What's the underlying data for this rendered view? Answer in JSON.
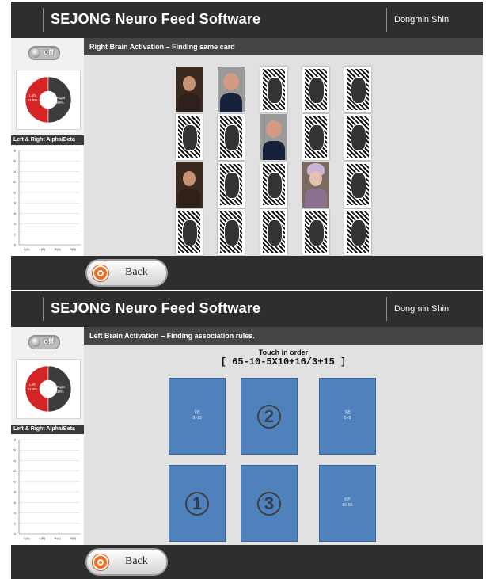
{
  "app": {
    "title": "SEJONG Neuro Feed Software",
    "user": "Dongmin Shin"
  },
  "sidebar": {
    "toggle_label": "off",
    "donut": {
      "left_label": "Left",
      "left_value": "51.8%",
      "right_label": "Right",
      "right_value": "49%",
      "left_color": "#d42424",
      "right_color": "#3c3c3c",
      "left_fraction": 0.5
    },
    "chart_title": "Left & Right Alpha/Beta"
  },
  "chart_data": {
    "type": "bar",
    "title": "Left & Right Alpha/Beta",
    "categories": [
      "L(A)",
      "L(B)",
      "R(A)",
      "R(B)"
    ],
    "values": [
      0,
      0,
      0,
      0
    ],
    "y_ticks": [
      "18",
      "16",
      "14",
      "12",
      "10",
      "8",
      "6",
      "4",
      "2",
      "0"
    ],
    "ylim": [
      0,
      18
    ],
    "grid": true
  },
  "screen1": {
    "panel_title": "Right Brain Activation – Finding same card",
    "cards": [
      [
        "girl",
        "man",
        "back",
        "back",
        "back"
      ],
      [
        "back",
        "back",
        "man",
        "back",
        "back"
      ],
      [
        "girl",
        "back",
        "back",
        "child",
        "back"
      ],
      [
        "back",
        "back",
        "back",
        "back",
        "back"
      ]
    ]
  },
  "screen2": {
    "panel_title": "Left Brain Activation – Finding association rules.",
    "instruction_line1": "Touch in order",
    "instruction_line2": "[ 65-10-5X10+16/3+15 ]",
    "tiles": [
      {
        "title": "1번",
        "expr": "8+15",
        "order": ""
      },
      {
        "title": "2번",
        "expr": "",
        "order": "2"
      },
      {
        "title": "3번",
        "expr": "5+3",
        "order": ""
      },
      {
        "title": "",
        "expr": "",
        "order": "1"
      },
      {
        "title": "",
        "expr": "",
        "order": "3"
      },
      {
        "title": "6번",
        "expr": "55-50",
        "order": ""
      }
    ]
  },
  "bottom": {
    "back_label": "Back"
  }
}
